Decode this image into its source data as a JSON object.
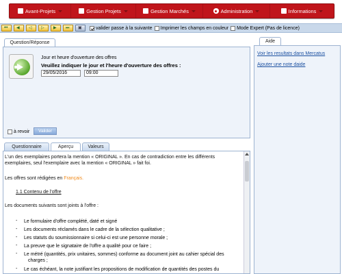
{
  "menu": {
    "items": [
      {
        "label": "Avant-Projets",
        "icon": "document-icon"
      },
      {
        "label": "Gestion Projets",
        "icon": "document-icon"
      },
      {
        "label": "Gestion Marchés",
        "icon": "document-icon"
      },
      {
        "label": "Administration",
        "icon": "gear-icon"
      },
      {
        "label": "Informations",
        "icon": "document-icon"
      }
    ],
    "accent": "#c0151b"
  },
  "toolbar": {
    "checkbox_next": "valider passe à la suivante",
    "checkbox_print": "Imprimer les champs en couleur",
    "checkbox_expert": "Mode Expert (Pas de licence)"
  },
  "question": {
    "tab_label": "Question/Réponse",
    "subtitle": "Jour et heure d'ouverture des offres",
    "title": "Veuillez indiquer le jour et l'heure d'ouverture des offres :",
    "date_value": "29/05/2016",
    "time_value": "09:00",
    "revoir_label": "à revoir",
    "valider_label": "Valider"
  },
  "aide": {
    "tab_label": "Aide",
    "link1": "Voir les resultats dans Mercatus",
    "link2": "Ajouter une note daide"
  },
  "bottom": {
    "tabs": [
      "Questionnaire",
      "Aperçu",
      "Valeurs"
    ],
    "p1a": "L'un des exemplaires portera la mention « ORIGINAL ». En cas de contradiction entre les différents",
    "p1b": "exemplaires, seul l'exemplaire avec la mention « ORIGINAL » fait foi.",
    "p2_prefix": "Les offres sont rédigées en ",
    "p2_lang": "Français.",
    "section": "1.1 Contenu de l'offre",
    "p3": "Les documents suivants sont joints à l'offre :",
    "list": [
      "Le formulaire d'offre complété, daté et signé",
      "Les documents réclamés dans le cadre de la sélection qualitative ;",
      "Les statuts du soumissionnaire si celui-ci est une personne morale ;",
      "La preuve que le signataire de l'offre a qualité pour ce faire ;",
      "Le métré (quantités, prix unitaires, sommes) conforme au document joint au cahier spécial des",
      "charges ;",
      "Le cas échéant, la note justifiant les propositions de modification de quantités des postes du"
    ]
  }
}
